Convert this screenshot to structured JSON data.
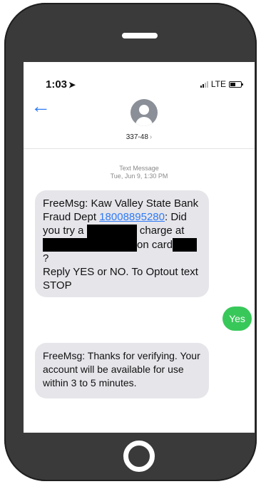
{
  "status_bar": {
    "time": "1:03",
    "network": "LTE"
  },
  "header": {
    "contact": "337-48",
    "back_label": "←",
    "chevron": "›"
  },
  "thread": {
    "meta_label": "Text Message",
    "meta_date": "Tue, Jun 9, 1:30 PM"
  },
  "messages": [
    {
      "direction": "incoming",
      "prefix": "FreeMsg: Kaw Valley State Bank Fraud Dept ",
      "phone_link": "18008895280",
      "p1": ": Did you try a ",
      "p2": " charge at",
      "p3": "on card",
      "p4": "?",
      "p5": "Reply YES or NO. To Optout text STOP"
    },
    {
      "direction": "outgoing",
      "text": "Yes"
    },
    {
      "direction": "incoming",
      "text": "FreeMsg: Thanks for verifying. Your account will be available for use within 3 to 5 minutes."
    }
  ],
  "colors": {
    "incoming_bubble": "#e6e5ea",
    "outgoing_bubble": "#38c85a",
    "link": "#2f7bf5",
    "phone_frame": "#3a3a3a"
  }
}
